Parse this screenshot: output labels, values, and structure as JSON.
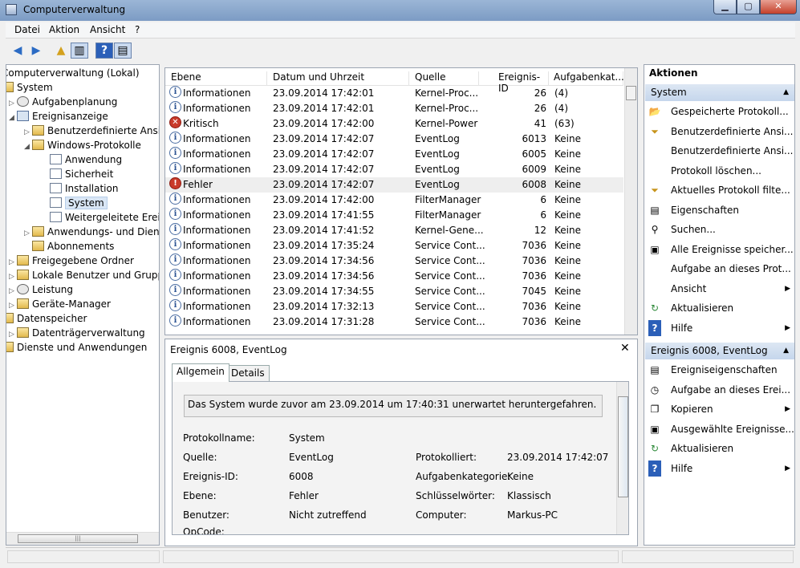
{
  "window": {
    "title": "Computerverwaltung"
  },
  "menu": [
    "Datei",
    "Aktion",
    "Ansicht",
    "?"
  ],
  "tree": [
    {
      "label": "Computerverwaltung (Lokal)",
      "level": 0,
      "icon": "computer-icon"
    },
    {
      "label": "System",
      "level": 0,
      "icon": "tools-icon"
    },
    {
      "label": "Aufgabenplanung",
      "level": 1,
      "icon": "clock-icon"
    },
    {
      "label": "Ereignisanzeige",
      "level": 1,
      "icon": "event-viewer-icon"
    },
    {
      "label": "Benutzerdefinierte Ansich",
      "level": 2,
      "icon": "folder-icon"
    },
    {
      "label": "Windows-Protokolle",
      "level": 2,
      "icon": "folder-icon"
    },
    {
      "label": "Anwendung",
      "level": 3,
      "icon": "log-icon"
    },
    {
      "label": "Sicherheit",
      "level": 3,
      "icon": "log-icon"
    },
    {
      "label": "Installation",
      "level": 3,
      "icon": "log-icon"
    },
    {
      "label": "System",
      "level": 3,
      "icon": "log-icon",
      "selected": true
    },
    {
      "label": "Weitergeleitete Ereign",
      "level": 3,
      "icon": "log-icon"
    },
    {
      "label": "Anwendungs- und Dienst",
      "level": 2,
      "icon": "folder-icon"
    },
    {
      "label": "Abonnements",
      "level": 2,
      "icon": "folder-icon"
    },
    {
      "label": "Freigegebene Ordner",
      "level": 1,
      "icon": "shared-folder-icon"
    },
    {
      "label": "Lokale Benutzer und Gruppen",
      "level": 1,
      "icon": "users-icon"
    },
    {
      "label": "Leistung",
      "level": 1,
      "icon": "performance-icon"
    },
    {
      "label": "Geräte-Manager",
      "level": 1,
      "icon": "device-manager-icon"
    },
    {
      "label": "Datenspeicher",
      "level": 0,
      "icon": "storage-icon"
    },
    {
      "label": "Datenträgerverwaltung",
      "level": 1,
      "icon": "disk-icon"
    },
    {
      "label": "Dienste und Anwendungen",
      "level": 0,
      "icon": "services-icon"
    }
  ],
  "list": {
    "columns": [
      "Ebene",
      "Datum und Uhrzeit",
      "Quelle",
      "Ereignis-ID",
      "Aufgabenkat..."
    ],
    "rows": [
      {
        "level": "Informationen",
        "type": "info",
        "date": "23.09.2014 17:42:01",
        "source": "Kernel-Proc...",
        "id": "26",
        "cat": "(4)"
      },
      {
        "level": "Informationen",
        "type": "info",
        "date": "23.09.2014 17:42:01",
        "source": "Kernel-Proc...",
        "id": "26",
        "cat": "(4)"
      },
      {
        "level": "Kritisch",
        "type": "crit",
        "date": "23.09.2014 17:42:00",
        "source": "Kernel-Power",
        "id": "41",
        "cat": "(63)"
      },
      {
        "level": "Informationen",
        "type": "info",
        "date": "23.09.2014 17:42:07",
        "source": "EventLog",
        "id": "6013",
        "cat": "Keine"
      },
      {
        "level": "Informationen",
        "type": "info",
        "date": "23.09.2014 17:42:07",
        "source": "EventLog",
        "id": "6005",
        "cat": "Keine"
      },
      {
        "level": "Informationen",
        "type": "info",
        "date": "23.09.2014 17:42:07",
        "source": "EventLog",
        "id": "6009",
        "cat": "Keine"
      },
      {
        "level": "Fehler",
        "type": "err",
        "date": "23.09.2014 17:42:07",
        "source": "EventLog",
        "id": "6008",
        "cat": "Keine",
        "selected": true
      },
      {
        "level": "Informationen",
        "type": "info",
        "date": "23.09.2014 17:42:00",
        "source": "FilterManager",
        "id": "6",
        "cat": "Keine"
      },
      {
        "level": "Informationen",
        "type": "info",
        "date": "23.09.2014 17:41:55",
        "source": "FilterManager",
        "id": "6",
        "cat": "Keine"
      },
      {
        "level": "Informationen",
        "type": "info",
        "date": "23.09.2014 17:41:52",
        "source": "Kernel-Gene...",
        "id": "12",
        "cat": "Keine"
      },
      {
        "level": "Informationen",
        "type": "info",
        "date": "23.09.2014 17:35:24",
        "source": "Service Cont...",
        "id": "7036",
        "cat": "Keine"
      },
      {
        "level": "Informationen",
        "type": "info",
        "date": "23.09.2014 17:34:56",
        "source": "Service Cont...",
        "id": "7036",
        "cat": "Keine"
      },
      {
        "level": "Informationen",
        "type": "info",
        "date": "23.09.2014 17:34:56",
        "source": "Service Cont...",
        "id": "7036",
        "cat": "Keine"
      },
      {
        "level": "Informationen",
        "type": "info",
        "date": "23.09.2014 17:34:55",
        "source": "Service Cont...",
        "id": "7045",
        "cat": "Keine"
      },
      {
        "level": "Informationen",
        "type": "info",
        "date": "23.09.2014 17:32:13",
        "source": "Service Cont...",
        "id": "7036",
        "cat": "Keine"
      },
      {
        "level": "Informationen",
        "type": "info",
        "date": "23.09.2014 17:31:28",
        "source": "Service Cont...",
        "id": "7036",
        "cat": "Keine"
      }
    ]
  },
  "detail": {
    "title": "Ereignis 6008, EventLog",
    "tabs": [
      "Allgemein",
      "Details"
    ],
    "message": "Das System wurde zuvor am 23.09.2014 um 17:40:31 unerwartet heruntergefahren.",
    "fields": {
      "protokollname_label": "Protokollname:",
      "protokollname": "System",
      "quelle_label": "Quelle:",
      "quelle": "EventLog",
      "protokolliert_label": "Protokolliert:",
      "protokolliert": "23.09.2014 17:42:07",
      "ereignisid_label": "Ereignis-ID:",
      "ereignisid": "6008",
      "aufgabenkat_label": "Aufgabenkategorie:",
      "aufgabenkat": "Keine",
      "ebene_label": "Ebene:",
      "ebene": "Fehler",
      "schluessel_label": "Schlüsselwörter:",
      "schluessel": "Klassisch",
      "benutzer_label": "Benutzer:",
      "benutzer": "Nicht zutreffend",
      "computer_label": "Computer:",
      "computer": "Markus-PC",
      "opcode_label": "OpCode:"
    }
  },
  "actions": {
    "title": "Aktionen",
    "section1": "System",
    "items1": [
      {
        "label": "Gespeicherte Protokoll...",
        "icon": "open-folder-icon"
      },
      {
        "label": "Benutzerdefinierte Ansi...",
        "icon": "filter-icon"
      },
      {
        "label": "Benutzerdefinierte Ansi...",
        "icon": ""
      },
      {
        "label": "Protokoll löschen...",
        "icon": ""
      },
      {
        "label": "Aktuelles Protokoll filte...",
        "icon": "filter-icon"
      },
      {
        "label": "Eigenschaften",
        "icon": "properties-icon"
      },
      {
        "label": "Suchen...",
        "icon": "binoculars-icon"
      },
      {
        "label": "Alle Ereignisse speicher...",
        "icon": "save-icon"
      },
      {
        "label": "Aufgabe an dieses Prot...",
        "icon": ""
      },
      {
        "label": "Ansicht",
        "icon": "",
        "submenu": true
      },
      {
        "label": "Aktualisieren",
        "icon": "refresh-icon"
      },
      {
        "label": "Hilfe",
        "icon": "help-icon",
        "submenu": true
      }
    ],
    "section2": "Ereignis 6008, EventLog",
    "items2": [
      {
        "label": "Ereigniseigenschaften",
        "icon": "properties-icon"
      },
      {
        "label": "Aufgabe an dieses Erei...",
        "icon": "task-icon"
      },
      {
        "label": "Kopieren",
        "icon": "copy-icon",
        "submenu": true
      },
      {
        "label": "Ausgewählte Ereignisse...",
        "icon": "save-icon"
      },
      {
        "label": "Aktualisieren",
        "icon": "refresh-icon"
      },
      {
        "label": "Hilfe",
        "icon": "help-icon",
        "submenu": true
      }
    ]
  },
  "colors": {
    "selection": "#d9e6f5",
    "error": "#c93a2a",
    "info": "#2d5493",
    "action_header": "#c5d6ec"
  }
}
